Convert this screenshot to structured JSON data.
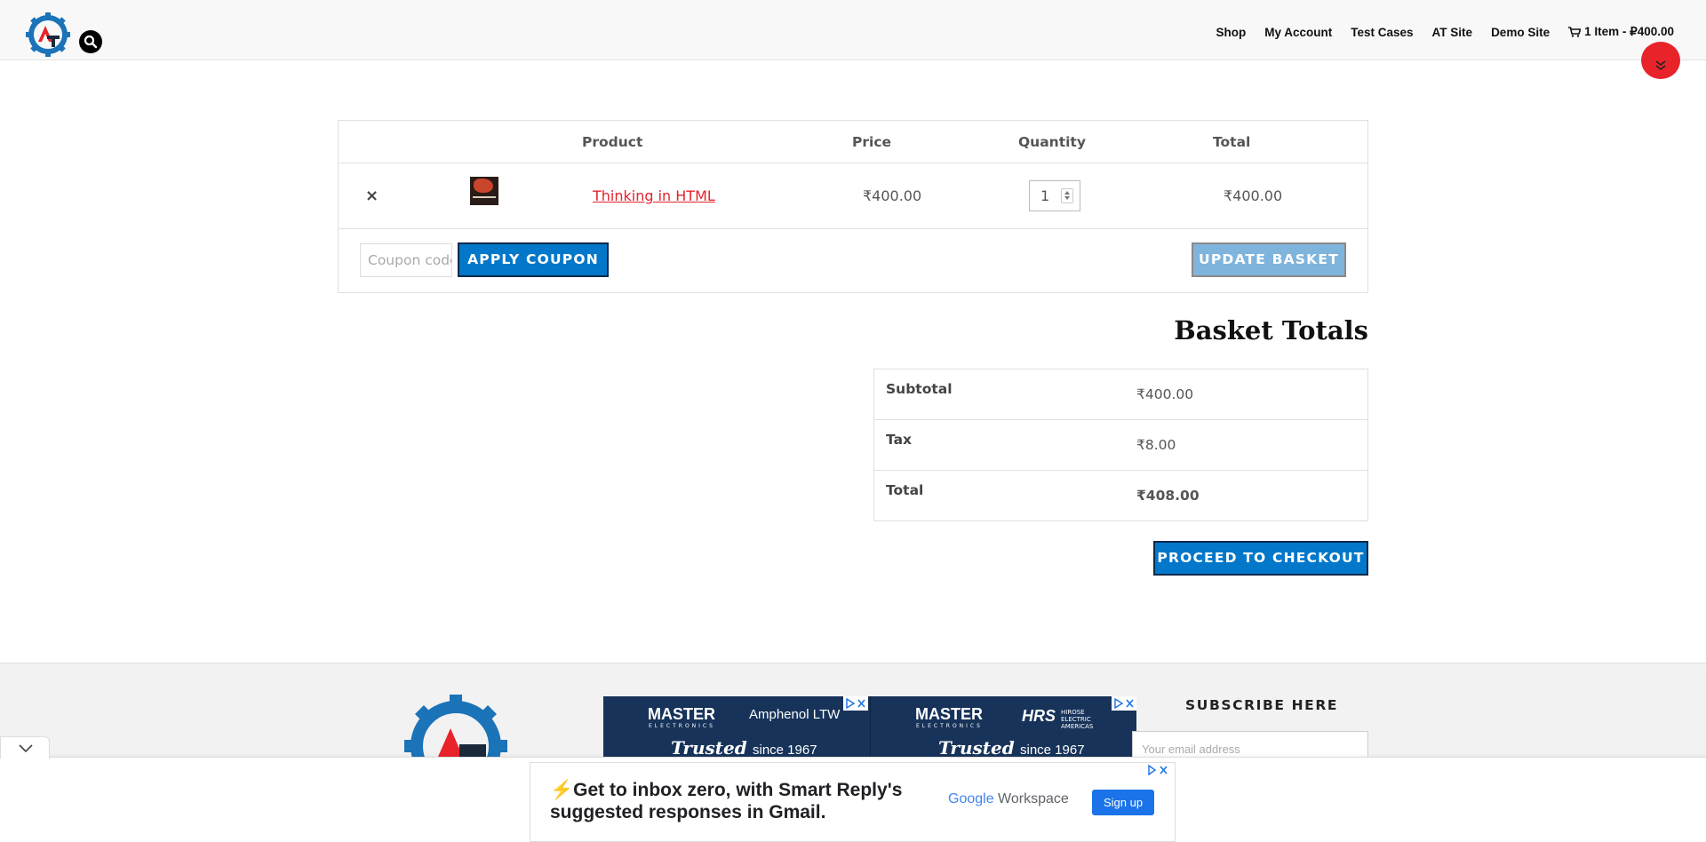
{
  "header": {
    "nav": [
      {
        "label": "Shop"
      },
      {
        "label": "My Account"
      },
      {
        "label": "Test Cases"
      },
      {
        "label": "AT Site"
      },
      {
        "label": "Demo Site"
      }
    ],
    "cart_label": "1 Item - ₽400.00"
  },
  "cart": {
    "headers": {
      "product": "Product",
      "price": "Price",
      "quantity": "Quantity",
      "total": "Total"
    },
    "items": [
      {
        "remove": "×",
        "name": "Thinking in HTML",
        "price": "₹400.00",
        "quantity": "1",
        "total": "₹400.00"
      }
    ],
    "coupon_placeholder": "Coupon code",
    "apply_label": "APPLY COUPON",
    "update_label": "UPDATE BASKET"
  },
  "totals": {
    "title": "Basket Totals",
    "rows": [
      {
        "label": "Subtotal",
        "value": "₹400.00"
      },
      {
        "label": "Tax",
        "value": "₹8.00"
      },
      {
        "label": "Total",
        "value": "₹408.00"
      }
    ],
    "checkout_label": "PROCEED TO CHECKOUT"
  },
  "footer": {
    "subscribe_title": "SUBSCRIBE HERE",
    "email_placeholder": "Your email address",
    "banner_ad": {
      "left_brand": "MASTER",
      "left_brand_sub": "ELECTRONICS",
      "left_partner": "Amphenol LTW",
      "left_tagline": "Trusted",
      "left_since": "since 1967",
      "right_brand": "MASTER",
      "right_brand_sub": "ELECTRONICS",
      "right_partner_logo": "HRS",
      "right_partner_text": "HIROSE ELECTRIC AMERICAS",
      "right_tagline": "Trusted",
      "right_since": "since 1967"
    }
  },
  "anchor_ad": {
    "headline": "Get to inbox zero, with Smart Reply's suggested responses in Gmail.",
    "brand_google": "Google",
    "brand_workspace": "Workspace",
    "cta": "Sign up"
  },
  "colors": {
    "accent_blue": "#0377c9",
    "product_link_red": "#e3232f",
    "logo_blue": "#1b73b8",
    "logo_red": "#e8232a"
  },
  "icons": [
    "logo-gear-icon",
    "search-icon",
    "cart-icon",
    "scroll-down-icon",
    "remove-icon",
    "collapse-chevron-icon",
    "adchoices-icon",
    "close-icon"
  ]
}
